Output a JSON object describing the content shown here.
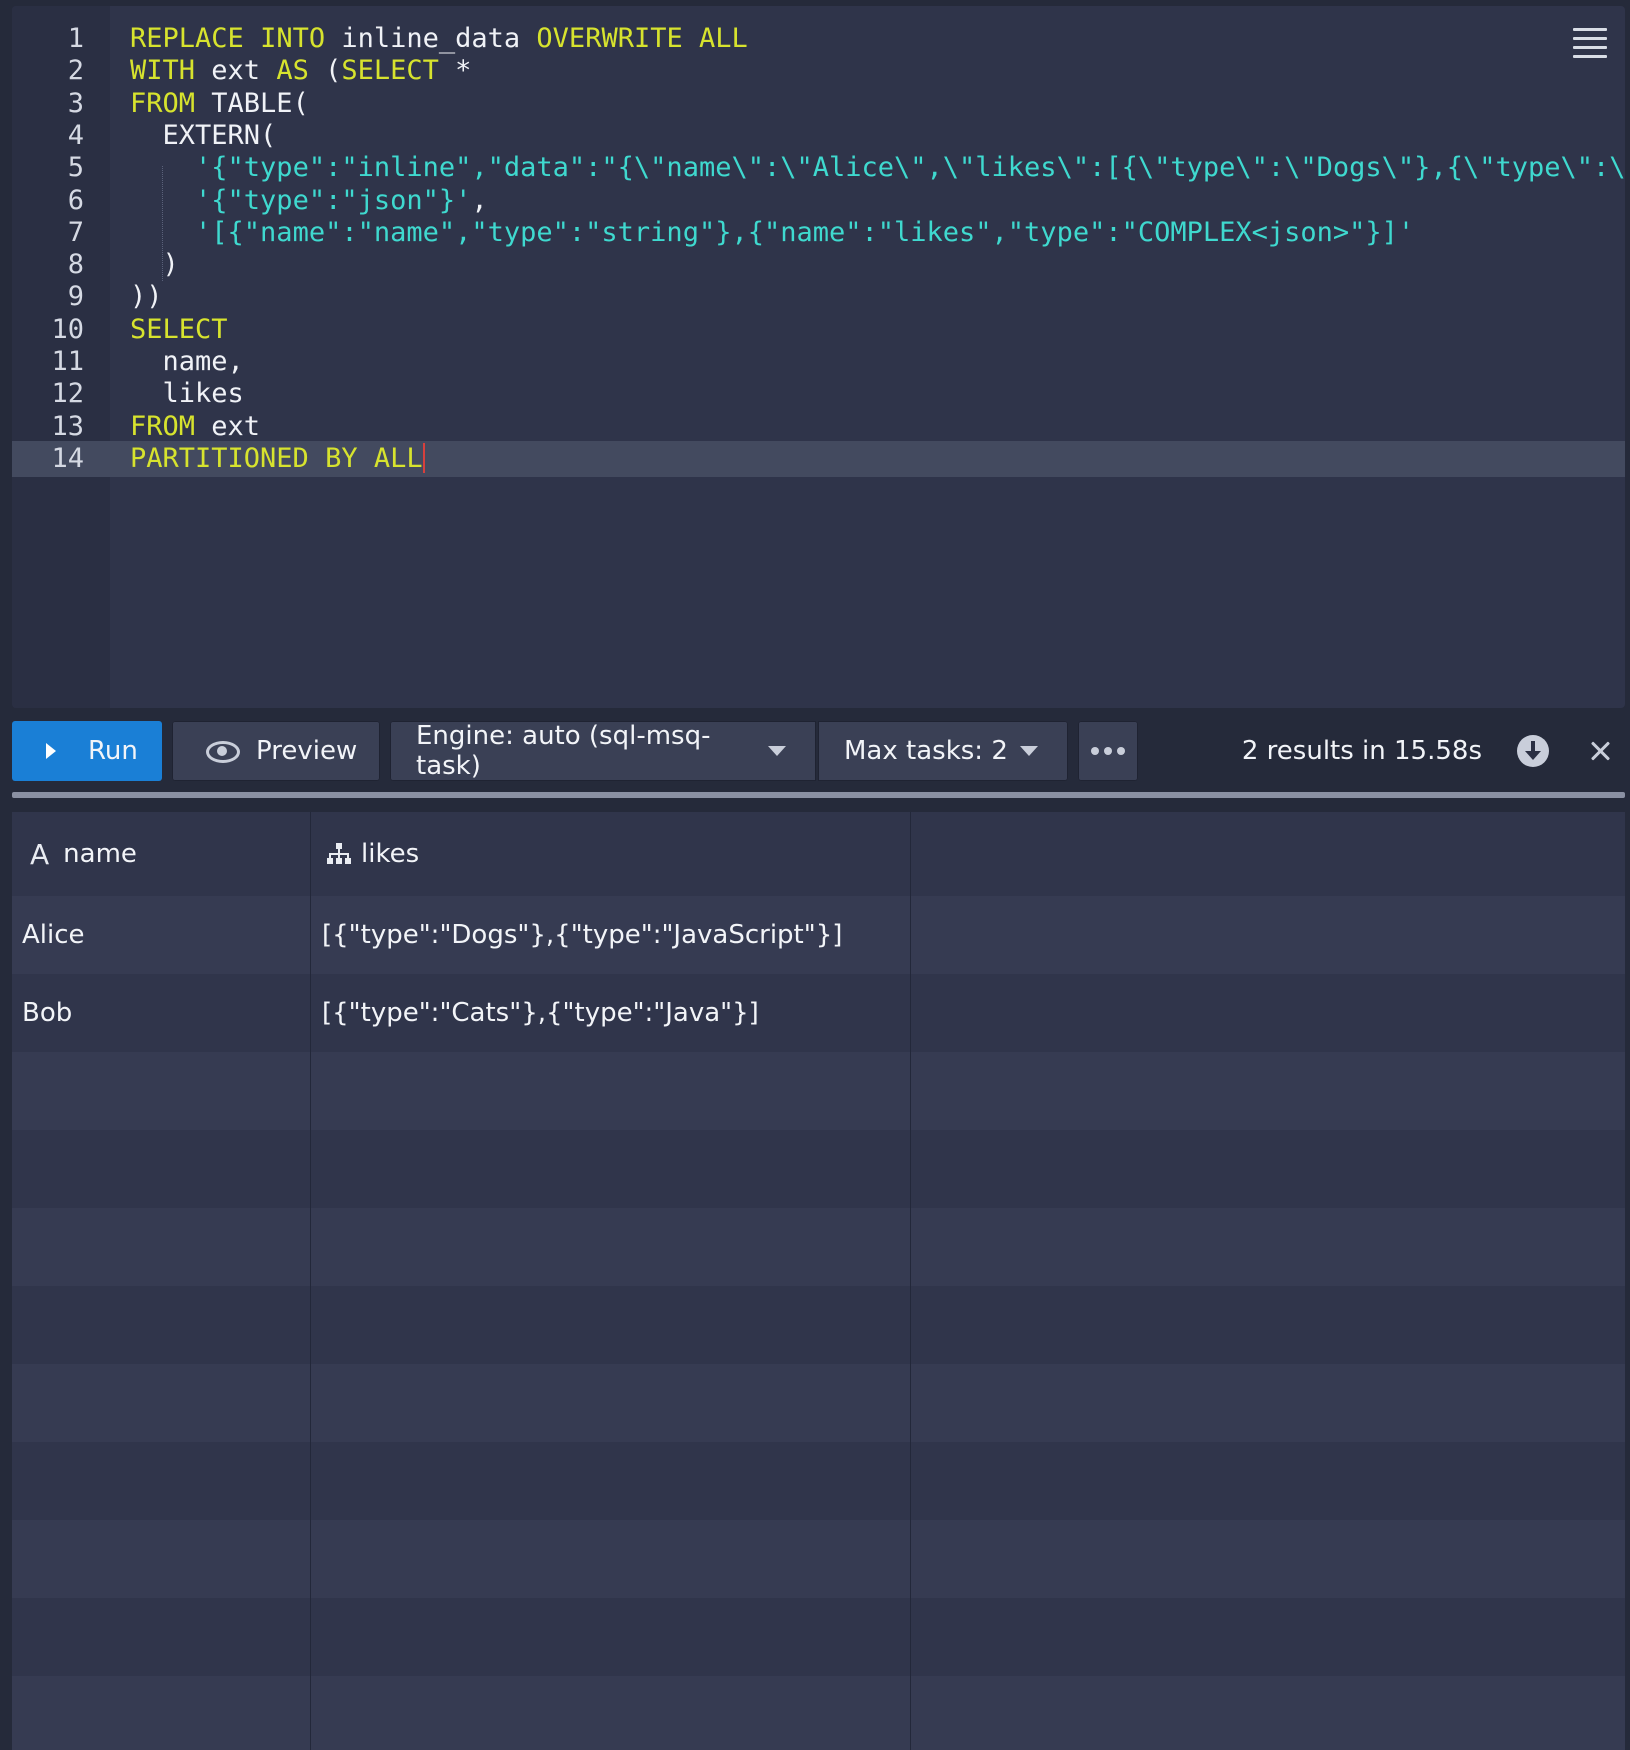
{
  "editor": {
    "lines": [
      {
        "num": "1",
        "tokens": [
          [
            "kw",
            "REPLACE"
          ],
          [
            "id",
            " "
          ],
          [
            "kw",
            "INTO"
          ],
          [
            "id",
            " inline_data "
          ],
          [
            "kw",
            "OVERWRITE"
          ],
          [
            "id",
            " "
          ],
          [
            "kw",
            "ALL"
          ]
        ]
      },
      {
        "num": "2",
        "tokens": [
          [
            "kw",
            "WITH"
          ],
          [
            "id",
            " ext "
          ],
          [
            "kw",
            "AS"
          ],
          [
            "id",
            " ("
          ],
          [
            "kw",
            "SELECT"
          ],
          [
            "id",
            " *"
          ]
        ]
      },
      {
        "num": "3",
        "tokens": [
          [
            "kw",
            "FROM"
          ],
          [
            "id",
            " TABLE("
          ]
        ]
      },
      {
        "num": "4",
        "tokens": [
          [
            "id",
            "  EXTERN("
          ]
        ]
      },
      {
        "num": "5",
        "tokens": [
          [
            "id",
            "    "
          ],
          [
            "str",
            "'{\"type\":\"inline\",\"data\":\"{\\\"name\\\":\\\"Alice\\\",\\\"likes\\\":[{\\\"type\\\":\\\"Dogs\\\"},{\\\"type\\\":\\\"Jav"
          ]
        ]
      },
      {
        "num": "6",
        "tokens": [
          [
            "id",
            "    "
          ],
          [
            "str",
            "'{\"type\":\"json\"}'"
          ],
          [
            "id",
            ","
          ]
        ]
      },
      {
        "num": "7",
        "tokens": [
          [
            "id",
            "    "
          ],
          [
            "str",
            "'[{\"name\":\"name\",\"type\":\"string\"},{\"name\":\"likes\",\"type\":\"COMPLEX<json>\"}]'"
          ]
        ]
      },
      {
        "num": "8",
        "tokens": [
          [
            "id",
            "  )"
          ]
        ]
      },
      {
        "num": "9",
        "tokens": [
          [
            "id",
            "))"
          ]
        ]
      },
      {
        "num": "10",
        "tokens": [
          [
            "kw",
            "SELECT"
          ]
        ]
      },
      {
        "num": "11",
        "tokens": [
          [
            "id",
            "  name,"
          ]
        ]
      },
      {
        "num": "12",
        "tokens": [
          [
            "id",
            "  likes"
          ]
        ]
      },
      {
        "num": "13",
        "tokens": [
          [
            "kw",
            "FROM"
          ],
          [
            "id",
            " ext"
          ]
        ]
      },
      {
        "num": "14",
        "tokens": [
          [
            "kw",
            "PARTITIONED"
          ],
          [
            "id",
            " "
          ],
          [
            "kw",
            "BY"
          ],
          [
            "id",
            " "
          ],
          [
            "kw",
            "ALL"
          ]
        ],
        "active": true
      }
    ]
  },
  "toolbar": {
    "run_label": "Run",
    "preview_label": "Preview",
    "engine_label": "Engine: auto (sql-msq-task)",
    "max_tasks_label": "Max tasks: 2",
    "status_text": "2 results in 15.58s"
  },
  "results": {
    "columns": [
      {
        "name": "name",
        "type_icon": "string-type-icon"
      },
      {
        "name": "likes",
        "type_icon": "complex-type-icon"
      }
    ],
    "rows": [
      [
        "Alice",
        "[{\"type\":\"Dogs\"},{\"type\":\"JavaScript\"}]"
      ],
      [
        "Bob",
        "[{\"type\":\"Cats\"},{\"type\":\"Java\"}]"
      ]
    ],
    "empty_rows": 9
  },
  "colors": {
    "keyword": "#d7e32e",
    "string": "#3fd9cf",
    "run_button": "#1a7fd6"
  }
}
